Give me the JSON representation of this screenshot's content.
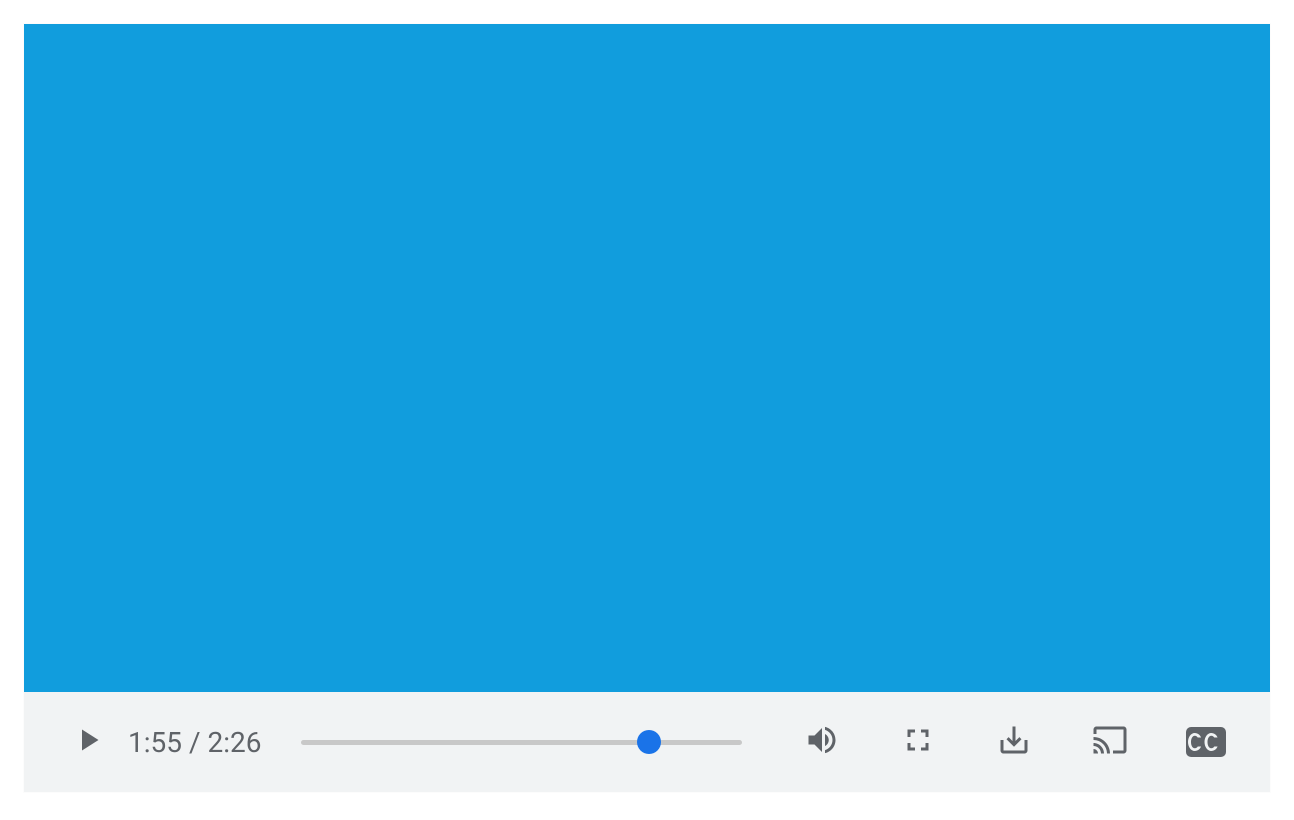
{
  "player": {
    "current_time": "1:55",
    "total_time": "2:26",
    "progress_percent": 78.8,
    "video_bg_color": "#119ddd",
    "thumb_color": "#1a73e8",
    "icon_color": "#5f6368",
    "cc_label": "CC"
  }
}
